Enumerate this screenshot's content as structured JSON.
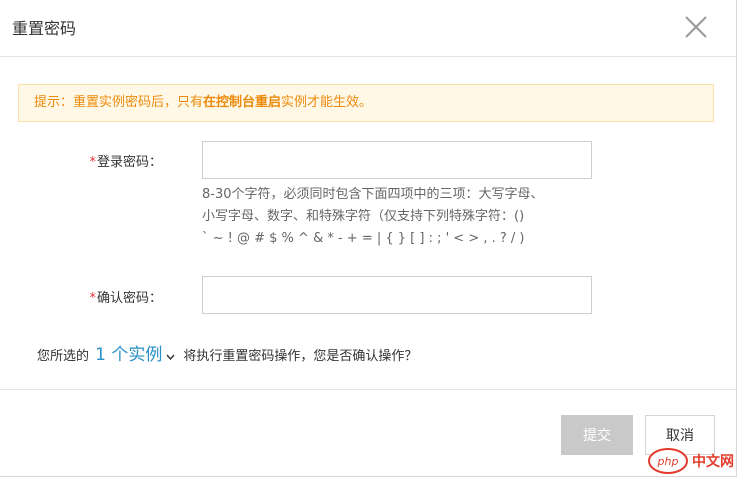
{
  "dialog": {
    "title": "重置密码"
  },
  "notice": {
    "prefix": "提示：重置实例密码后，只有",
    "emphasis": "在控制台重启",
    "suffix": "实例才能生效。"
  },
  "form": {
    "password": {
      "required_mark": "*",
      "label": "登录密码：",
      "value": "",
      "placeholder": ""
    },
    "password_hint": [
      "8-30个字符，必须同时包含下面四项中的三项：大写字母、",
      "小写字母、数字、和特殊字符（仅支持下列特殊字符：()",
      "` ~ ! @ # $ % ^ & * - + = | { } [ ] : ; ' < > , . ? / )"
    ],
    "confirm_password": {
      "required_mark": "*",
      "label": "确认密码：",
      "value": "",
      "placeholder": ""
    }
  },
  "confirm_text": {
    "prefix": "您所选的",
    "instances_link": "1 个实例",
    "suffix": "将执行重置密码操作，您是否确认操作？"
  },
  "buttons": {
    "submit": "提交",
    "cancel": "取消"
  },
  "watermark": {
    "logo_text": "php",
    "site_text": "中文网"
  },
  "colors": {
    "accent_link": "#2a91c8",
    "notice_text": "#ec8a0c",
    "notice_bg": "#fff8e6",
    "required": "#e0383e",
    "submit_disabled": "#c9c9c9"
  },
  "icons": {
    "close": "close-icon",
    "chevron": "chevron-down-icon"
  }
}
